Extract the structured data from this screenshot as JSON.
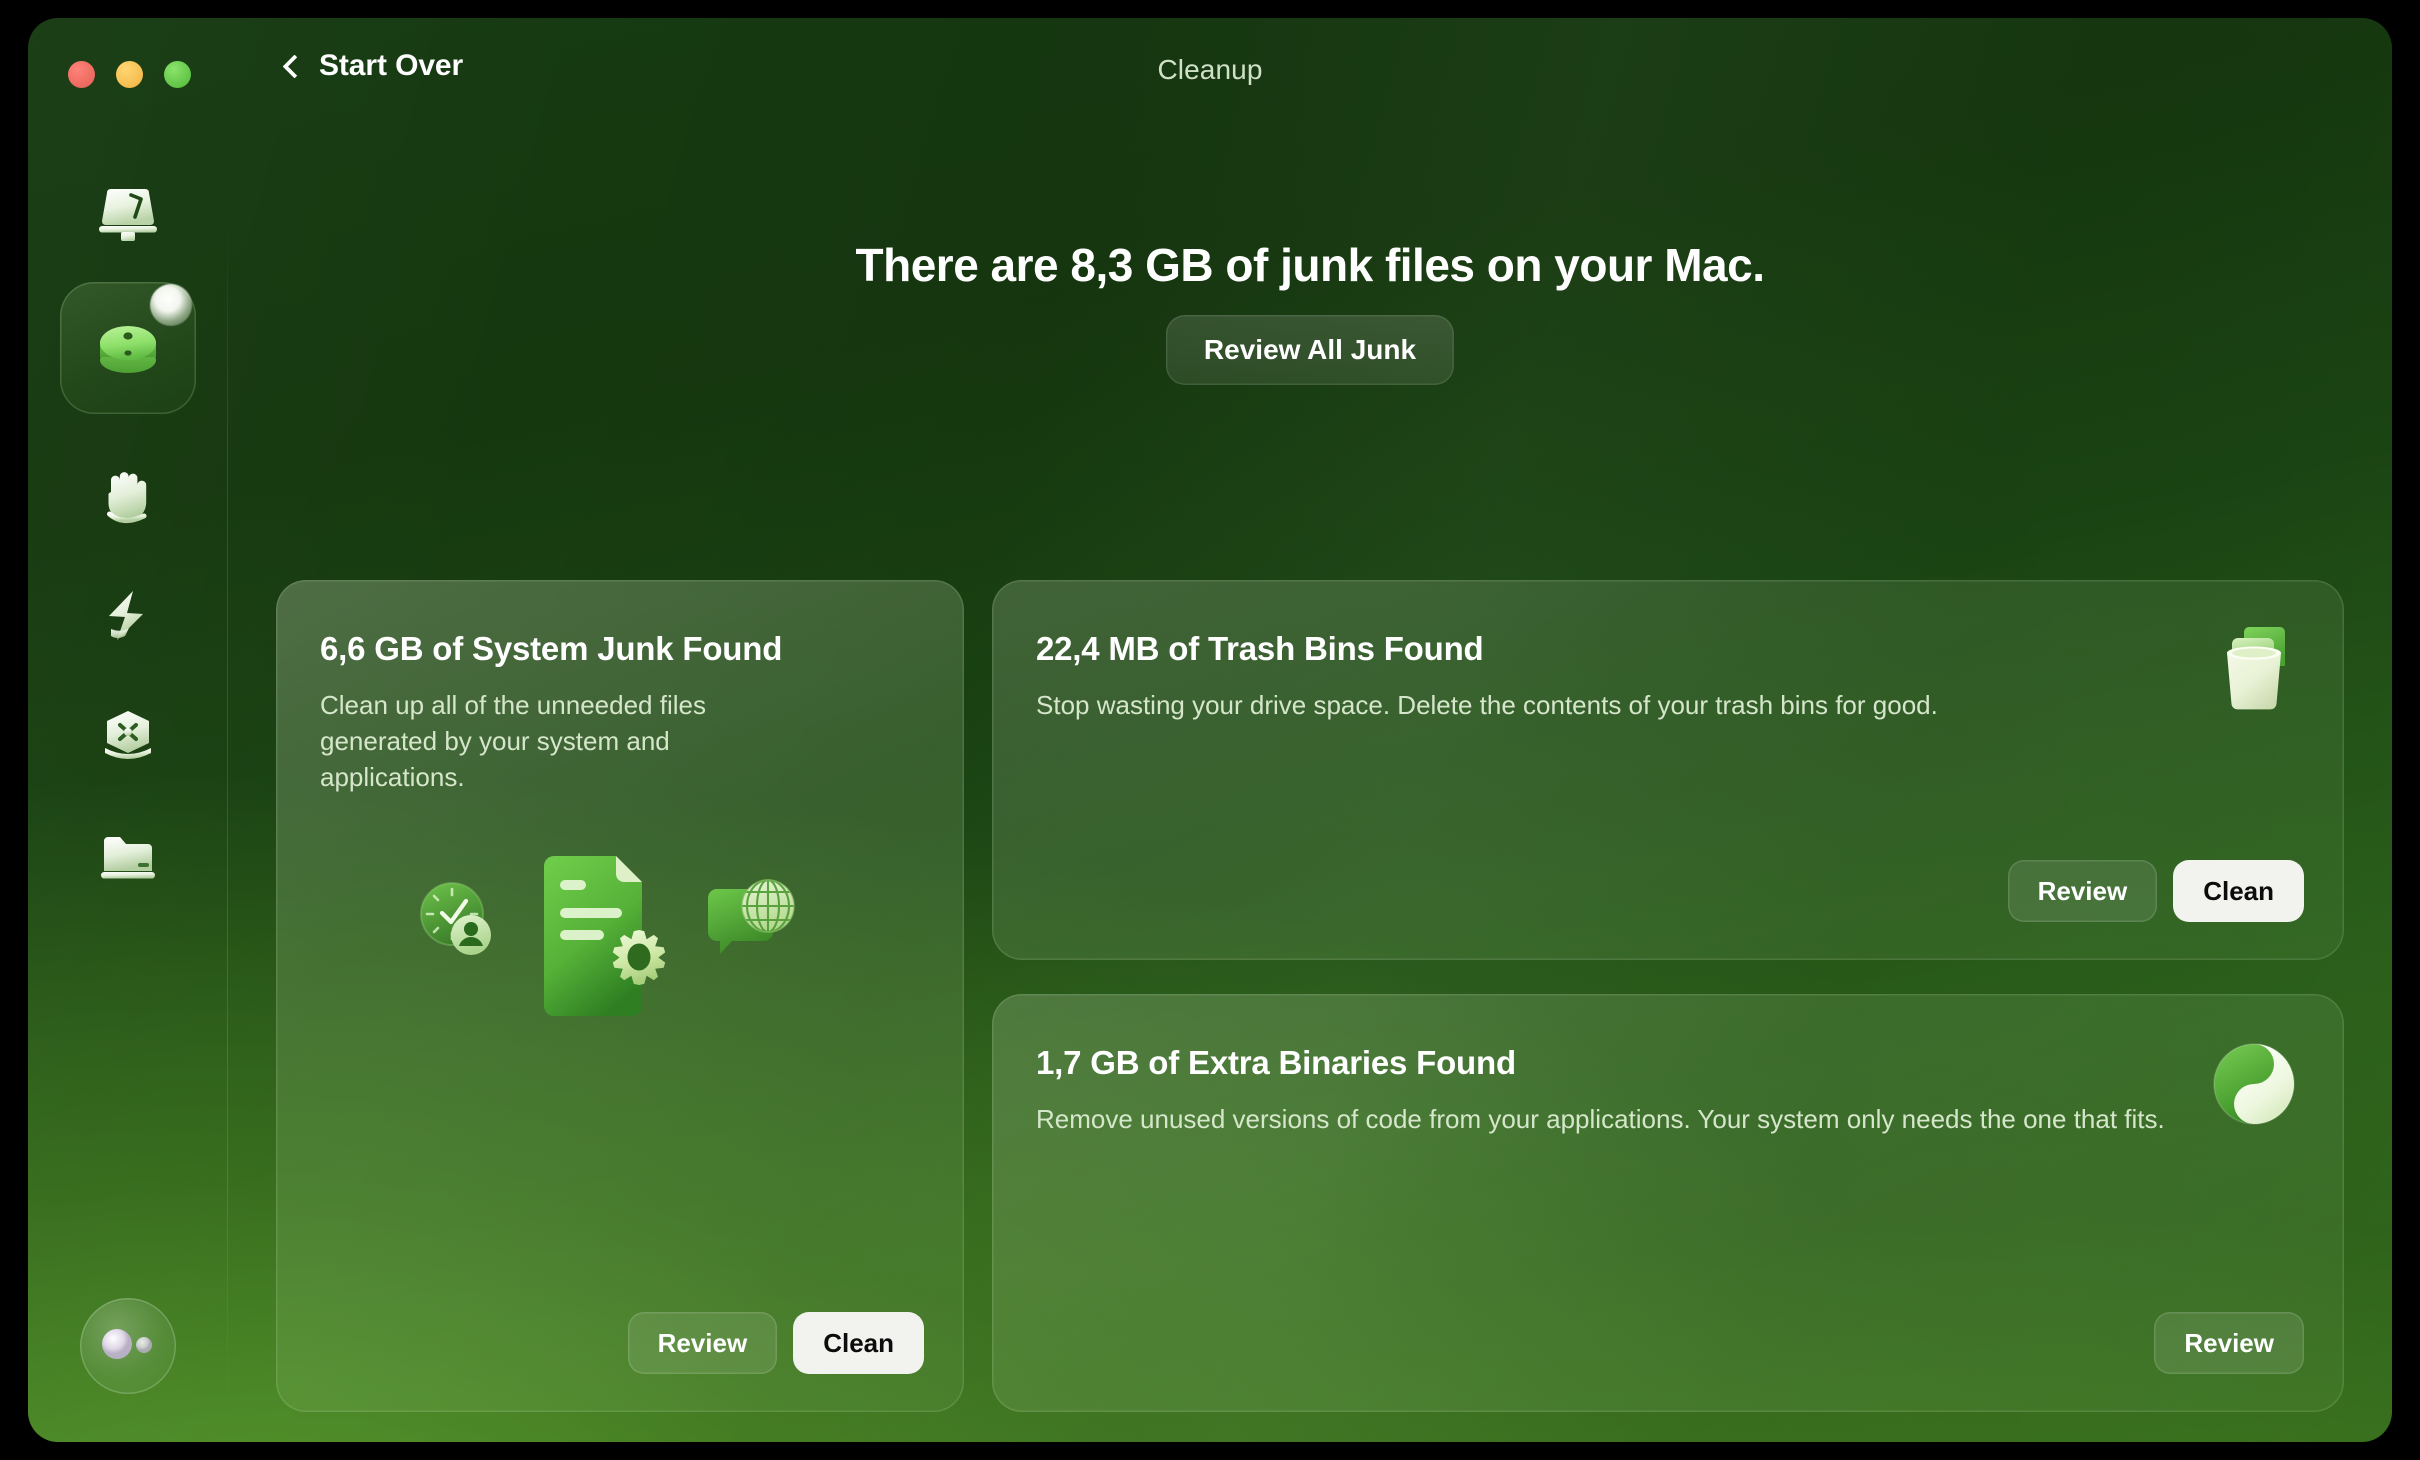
{
  "window": {
    "title": "Cleanup",
    "back_label": "Start Over",
    "traffic_lights": [
      "close",
      "minimize",
      "zoom"
    ]
  },
  "main": {
    "headline": "There are 8,3 GB of junk files on your Mac.",
    "review_all_label": "Review All Junk"
  },
  "sidebar": {
    "items": [
      {
        "id": "smart-scan",
        "icon": "scanner-icon",
        "active": false
      },
      {
        "id": "cleanup",
        "icon": "cleanup-icon",
        "active": true,
        "badge": true
      },
      {
        "id": "protection",
        "icon": "hand-icon",
        "active": false
      },
      {
        "id": "performance",
        "icon": "lightning-icon",
        "active": false
      },
      {
        "id": "applications",
        "icon": "hex-tool-icon",
        "active": false
      },
      {
        "id": "my-clutter",
        "icon": "folder-icon",
        "active": false
      }
    ],
    "profile": {
      "id": "account",
      "icon": "account-orb-icon"
    }
  },
  "cards": [
    {
      "id": "system-junk",
      "title": "6,6 GB of System Junk Found",
      "description": "Clean up all of the unneeded files generated by your system and applications.",
      "icon": "system-junk-illustration",
      "buttons": [
        {
          "id": "review",
          "label": "Review",
          "style": "secondary"
        },
        {
          "id": "clean",
          "label": "Clean",
          "style": "primary"
        }
      ]
    },
    {
      "id": "trash-bins",
      "title": "22,4 MB of Trash Bins Found",
      "description": "Stop wasting your drive space. Delete the contents of your trash bins for good.",
      "icon": "trash-bin-icon",
      "buttons": [
        {
          "id": "review",
          "label": "Review",
          "style": "secondary"
        },
        {
          "id": "clean",
          "label": "Clean",
          "style": "primary"
        }
      ]
    },
    {
      "id": "extra-binaries",
      "title": "1,7 GB of Extra Binaries Found",
      "description": "Remove unused versions of code from your applications. Your system only needs the one that fits.",
      "icon": "binaries-orb-icon",
      "buttons": [
        {
          "id": "review",
          "label": "Review",
          "style": "secondary"
        }
      ]
    }
  ],
  "colors": {
    "window_top": "#16380f",
    "window_bottom": "#35701f",
    "accent_green": "#7ed65c",
    "primary_button_bg": "#f2f2ee",
    "primary_button_text": "#0c0c0c",
    "title_text": "#cfe0c6",
    "body_text": "#d5e6cb"
  }
}
